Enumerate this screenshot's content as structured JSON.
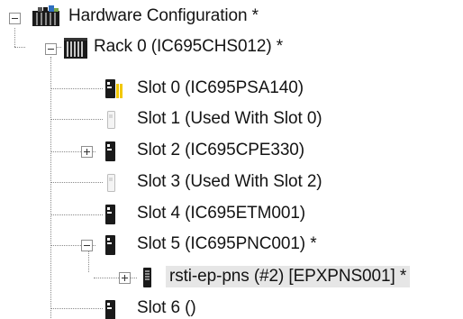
{
  "tree": {
    "root": {
      "label": "Hardware Configuration *",
      "icon": "hardware-configuration-icon",
      "expanded": true
    },
    "rack": {
      "label": "Rack 0 (IC695CHS012) *",
      "icon": "rack-icon",
      "expanded": true
    },
    "slots": [
      {
        "label": "Slot 0 (IC695PSA140)",
        "icon": "power-supply-module-icon"
      },
      {
        "label": "Slot 1 (Used With Slot 0)",
        "icon": "empty-slot-icon"
      },
      {
        "label": "Slot 2 (IC695CPE330)",
        "icon": "module-icon",
        "expanded": false
      },
      {
        "label": "Slot 3 (Used With Slot 2)",
        "icon": "empty-slot-icon"
      },
      {
        "label": "Slot 4 (IC695ETM001)",
        "icon": "module-icon"
      },
      {
        "label": "Slot 5 (IC695PNC001) *",
        "icon": "module-icon",
        "expanded": true
      },
      {
        "label": "rsti-ep-pns (#2) [EPXPNS001] *",
        "icon": "network-device-icon",
        "expanded": false,
        "selected": true
      },
      {
        "label": "Slot 6 ()",
        "icon": "module-icon"
      }
    ]
  },
  "colors": {
    "text": "#141414",
    "selection": "#e6e6e6",
    "module": "#1a1a1a",
    "power_stripe": "#f2c800"
  }
}
